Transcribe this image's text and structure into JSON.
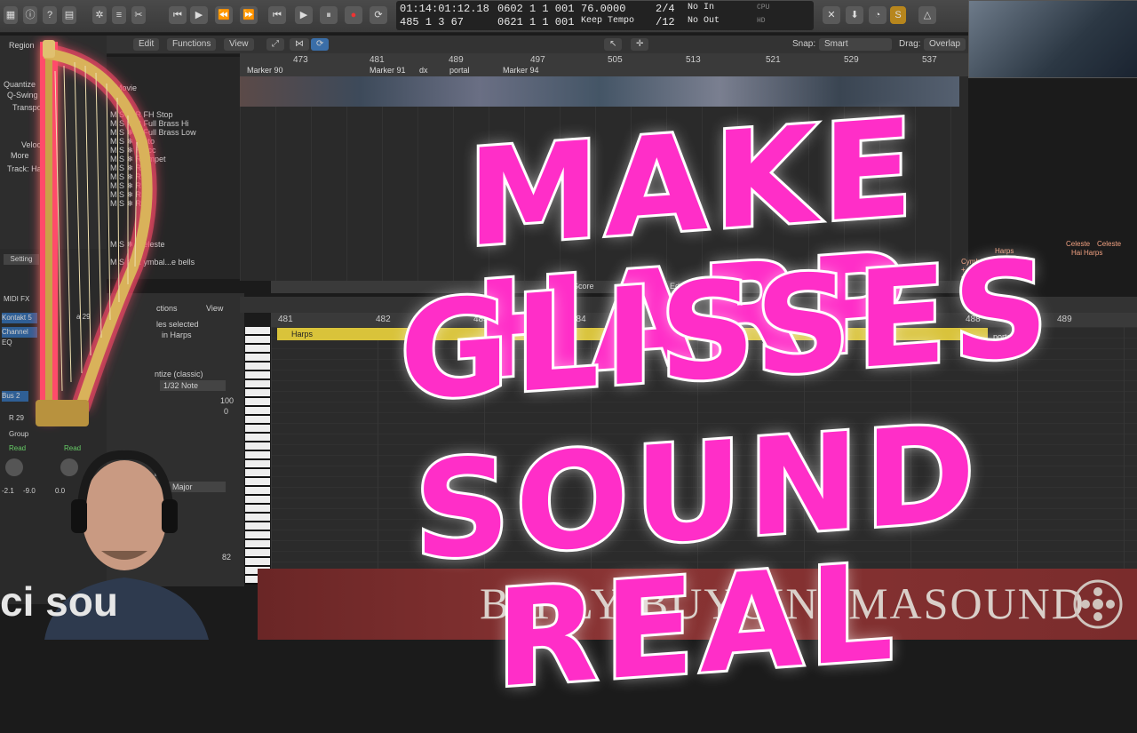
{
  "controlbar": {
    "lcd_time": "01:14:01:12.18",
    "lcd_bars": "485  1  3   67",
    "lcd_pos1": "0602  1  1  001",
    "lcd_pos2": "0621  1  1  001",
    "tempo": "76.0000",
    "tempo_mode": "Keep Tempo",
    "signature": "2/4",
    "division": "/12",
    "midi_in": "No In",
    "midi_out": "No Out",
    "cpu_label": "CPU",
    "hd_label": "HD"
  },
  "toolbar": {
    "edit": "Edit",
    "functions": "Functions",
    "view": "View",
    "snap_label": "Snap:",
    "snap_value": "Smart",
    "drag_label": "Drag:",
    "drag_value": "Overlap"
  },
  "ruler": {
    "ticks": [
      "473",
      "481",
      "489",
      "497",
      "505",
      "513",
      "521",
      "529",
      "537"
    ],
    "markers": [
      "Marker 90",
      "Marker 91",
      "dx",
      "portal",
      "Marker 94"
    ]
  },
  "inspector": {
    "region": "Region",
    "quantize": "Quantize",
    "qswing": "Q-Swing",
    "transpose": "Transpos",
    "velocity": "Velocity",
    "more": "More",
    "track": "Track: Har",
    "movie": "Movie"
  },
  "tracks": [
    "FH Stop",
    "Full Brass Hi",
    "Full Brass Low",
    "ato",
    "acc",
    "umpet",
    "",
    "",
    "",
    "",
    "",
    "eleste",
    "ymbal...e bells"
  ],
  "arrange_regions": {
    "harps": "Harps",
    "celeste1": "Celeste",
    "celeste2": "Celeste",
    "hai": "Hai",
    "harps2": "Harps",
    "cymbals": "Cymbals + scrapes + tube be"
  },
  "editor": {
    "tabs": [
      "Score",
      "Step Editor"
    ],
    "functions": "ctions",
    "view": "View",
    "selected": "les selected",
    "in_harps": "in Harps",
    "quantize_label": "ntize (classic)",
    "quantize_value": "1/32 Note",
    "q_val1": "100",
    "q_val2": "0",
    "scale_label": "ize",
    "scale_value": "Major",
    "ruler": [
      "481",
      "482",
      "483",
      "484",
      "488",
      "489"
    ],
    "region_name": "Harps",
    "portal": "portal",
    "bottom_value": "82"
  },
  "mixer": {
    "setting": "Setting",
    "midi_fx": "MIDI FX",
    "kontakt": "Kontakt 5",
    "channel_eq": "Channel EQ",
    "bus": "Bus 2",
    "r29a": "R 29",
    "r29b": "a 29",
    "group": "Group",
    "read1": "Read",
    "read2": "Read",
    "vol1": "-2.1",
    "vol2": "-9.0",
    "vol3": "0.0"
  },
  "headline": {
    "line1": "MAKE HARP",
    "line2": "GLISSES",
    "line3": "SOUND REAL"
  },
  "banner": {
    "url": "BIT.LY/BUYCINEMASOUND",
    "logo": "ci    sou"
  },
  "colors": {
    "headline": "#ff2ec8",
    "outline": "#ffffff",
    "region_yellow": "#d9c33a",
    "banner_red": "#8a3434"
  }
}
